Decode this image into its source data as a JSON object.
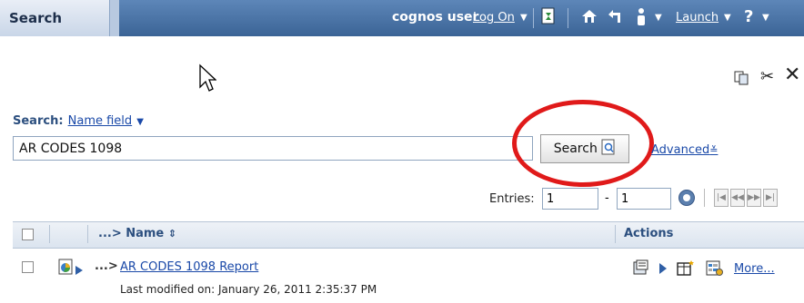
{
  "header": {
    "tab_title": "Search",
    "user_name": "cognos user",
    "log_on": "Log On",
    "launch": "Launch",
    "help": "?"
  },
  "search": {
    "label": "Search:",
    "field_selector": "Name field",
    "query_value": "AR CODES 1098",
    "button_label": "Search",
    "advanced_label": "Advanced"
  },
  "entries": {
    "label": "Entries:",
    "from": "1",
    "dash": "-",
    "to": "1"
  },
  "table": {
    "columns": [
      "...> Name",
      "Actions"
    ],
    "rows": [
      {
        "prefix": "...>",
        "name": "AR CODES 1098 Report",
        "modified": "Last modified on: January 26, 2011 2:35:37 PM",
        "more": "More..."
      }
    ]
  },
  "colors": {
    "topbar": "#3b6496",
    "link": "#1a49a8",
    "annotation_circle": "#e01a1a"
  },
  "icons": [
    "copy-icon",
    "cut-icon",
    "delete-icon",
    "home-icon",
    "back-icon",
    "user-icon",
    "help-icon",
    "refresh-icon",
    "search-go-icon",
    "report-icon",
    "run-icon",
    "properties-icon",
    "schedule-icon"
  ]
}
